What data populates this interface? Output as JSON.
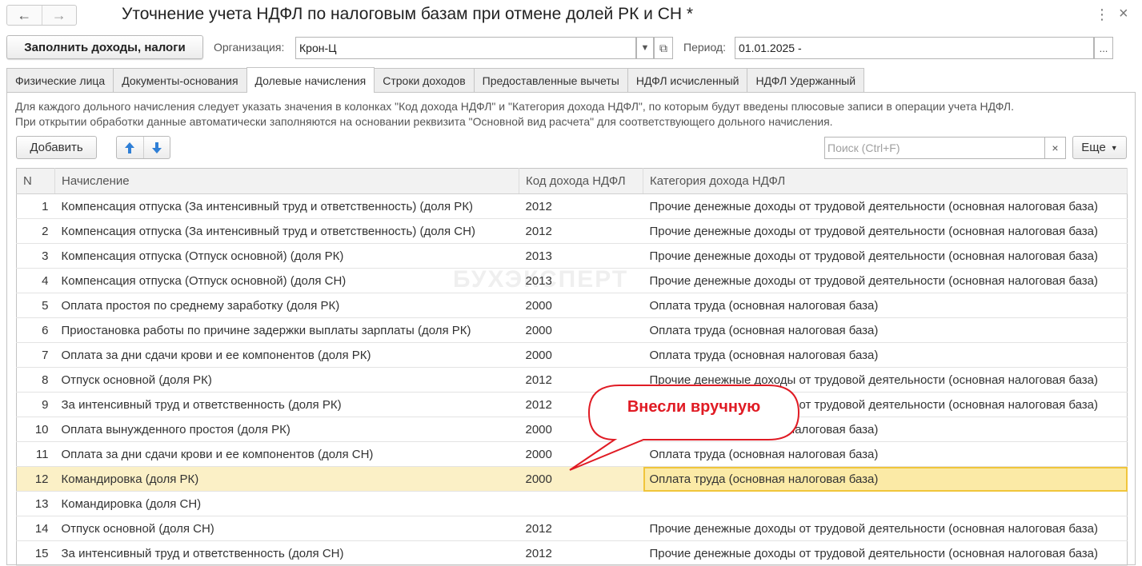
{
  "window": {
    "title": "Уточнение учета НДФЛ по налоговым базам при отмене долей РК и СН *",
    "back_icon": "←",
    "forward_icon": "→",
    "more_icon": "⋮",
    "close_icon": "×"
  },
  "toolbar": {
    "fill_button": "Заполнить доходы, налоги",
    "org_label": "Организация:",
    "org_value": "Крон-Ц",
    "period_label": "Период:",
    "period_value": "01.01.2025 -",
    "dropdown_icon": "▼",
    "open_icon": "⧉",
    "choose_icon": "..."
  },
  "tabs": [
    {
      "label": "Физические лица",
      "active": false
    },
    {
      "label": "Документы-основания",
      "active": false
    },
    {
      "label": "Долевые начисления",
      "active": true
    },
    {
      "label": "Строки доходов",
      "active": false
    },
    {
      "label": "Предоставленные вычеты",
      "active": false
    },
    {
      "label": "НДФЛ исчисленный",
      "active": false
    },
    {
      "label": "НДФЛ Удержанный",
      "active": false
    }
  ],
  "info": {
    "line1": "Для каждого дольного начисления следует указать значения в колонках \"Код дохода НДФЛ\" и \"Категория дохода НДФЛ\", по которым будут введены плюсовые записи в операции учета НДФЛ.",
    "line2": "При открытии обработки данные автоматически заполняются на основании реквизита \"Основной вид расчета\" для соответствующего дольного начисления."
  },
  "table_toolbar": {
    "add_button": "Добавить",
    "search_placeholder": "Поиск (Ctrl+F)",
    "clear_icon": "×",
    "more_button": "Еще"
  },
  "grid": {
    "headers": [
      "N",
      "Начисление",
      "Код дохода НДФЛ",
      "Категория дохода НДФЛ"
    ],
    "selected_index": 11,
    "rows": [
      {
        "n": "1",
        "name": "Компенсация отпуска (За интенсивный труд и ответственность) (доля РК)",
        "code": "2012",
        "category": "Прочие денежные доходы от трудовой деятельности (основная налоговая база)"
      },
      {
        "n": "2",
        "name": "Компенсация отпуска (За интенсивный труд и ответственность) (доля СН)",
        "code": "2012",
        "category": "Прочие денежные доходы от трудовой деятельности (основная налоговая база)"
      },
      {
        "n": "3",
        "name": "Компенсация отпуска (Отпуск основной) (доля РК)",
        "code": "2013",
        "category": "Прочие денежные доходы от трудовой деятельности (основная налоговая база)"
      },
      {
        "n": "4",
        "name": "Компенсация отпуска (Отпуск основной) (доля СН)",
        "code": "2013",
        "category": "Прочие денежные доходы от трудовой деятельности (основная налоговая база)"
      },
      {
        "n": "5",
        "name": "Оплата простоя по среднему заработку (доля РК)",
        "code": "2000",
        "category": "Оплата труда (основная налоговая база)"
      },
      {
        "n": "6",
        "name": "Приостановка работы по причине задержки выплаты зарплаты (доля РК)",
        "code": "2000",
        "category": "Оплата труда (основная налоговая база)"
      },
      {
        "n": "7",
        "name": "Оплата за дни сдачи крови и ее компонентов (доля РК)",
        "code": "2000",
        "category": "Оплата труда (основная налоговая база)"
      },
      {
        "n": "8",
        "name": "Отпуск основной (доля РК)",
        "code": "2012",
        "category": "Прочие денежные доходы от трудовой деятельности (основная налоговая база)"
      },
      {
        "n": "9",
        "name": "За интенсивный труд и ответственность (доля РК)",
        "code": "2012",
        "category": "Прочие денежные доходы от трудовой деятельности (основная налоговая база)"
      },
      {
        "n": "10",
        "name": "Оплата вынужденного простоя (доля РК)",
        "code": "2000",
        "category": "Оплата труда (основная налоговая база)"
      },
      {
        "n": "11",
        "name": "Оплата за дни сдачи крови и ее компонентов (доля СН)",
        "code": "2000",
        "category": "Оплата труда (основная налоговая база)"
      },
      {
        "n": "12",
        "name": "Командировка (доля РК)",
        "code": "2000",
        "category": "Оплата труда (основная налоговая база)"
      },
      {
        "n": "13",
        "name": "Командировка (доля СН)",
        "code": "",
        "category": ""
      },
      {
        "n": "14",
        "name": "Отпуск основной (доля СН)",
        "code": "2012",
        "category": "Прочие денежные доходы от трудовой деятельности (основная налоговая база)"
      },
      {
        "n": "15",
        "name": "За интенсивный труд и ответственность (доля СН)",
        "code": "2012",
        "category": "Прочие денежные доходы от трудовой деятельности (основная налоговая база)"
      }
    ]
  },
  "watermark": "БУХЭКСПЕРТ",
  "callout": {
    "text": "Внесли вручную",
    "color": "#e01b24"
  }
}
